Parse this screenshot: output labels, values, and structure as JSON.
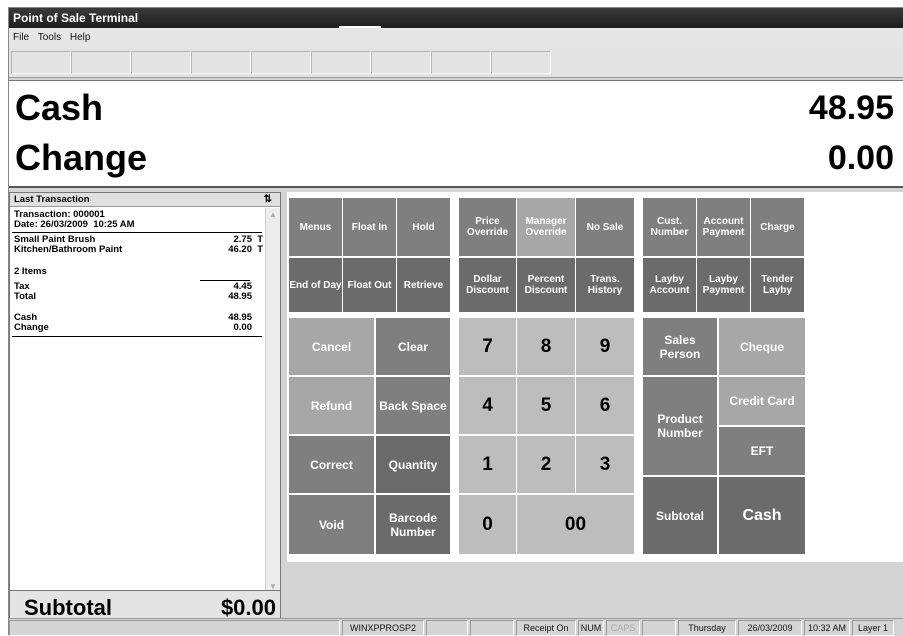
{
  "window": {
    "title": "Point of Sale Terminal"
  },
  "menu": {
    "items": [
      "File",
      "Tools",
      "Help"
    ]
  },
  "display": {
    "line1_label": "Cash",
    "line1_value": "48.95",
    "line2_label": "Change",
    "line2_value": "0.00"
  },
  "receipt": {
    "header": "Last Transaction",
    "sort_icon": "⇅",
    "transaction": "Transaction: 000001",
    "date": "Date: 26/03/2009  10:25 AM",
    "items": [
      {
        "name": "Small Paint Brush",
        "price": "2.75",
        "flag": "T"
      },
      {
        "name": "Kitchen/Bathroom Paint",
        "price": "46.20",
        "flag": "T"
      }
    ],
    "item_count": "2 Items",
    "tax_label": "Tax",
    "tax": "4.45",
    "total_label": "Total",
    "total": "48.95",
    "cash_label": "Cash",
    "cash": "48.95",
    "change_label": "Change",
    "change": "0.00"
  },
  "subtotal": {
    "label": "Subtotal",
    "value": "$0.00"
  },
  "keys": {
    "menus": "Menus",
    "float_in": "Float In",
    "hold": "Hold",
    "price_override": "Price Override",
    "manager_override": "Manager Override",
    "no_sale": "No Sale",
    "cust_number": "Cust. Number",
    "account_payment": "Account Payment",
    "charge": "Charge",
    "end_of_day": "End of Day",
    "float_out": "Float Out",
    "retrieve": "Retrieve",
    "dollar_discount": "Dollar Discount",
    "percent_discount": "Percent Discount",
    "trans_history": "Trans. History",
    "layby_account": "Layby Account",
    "layby_payment": "Layby Payment",
    "tender_layby": "Tender Layby",
    "cancel": "Cancel",
    "clear": "Clear",
    "refund": "Refund",
    "back_space": "Back Space",
    "correct": "Correct",
    "quantity": "Quantity",
    "void": "Void",
    "barcode_number": "Barcode Number",
    "n7": "7",
    "n8": "8",
    "n9": "9",
    "n4": "4",
    "n5": "5",
    "n6": "6",
    "n1": "1",
    "n2": "2",
    "n3": "3",
    "n0": "0",
    "n00": "00",
    "sales_person": "Sales Person",
    "product_number": "Product Number",
    "subtotal": "Subtotal",
    "cheque": "Cheque",
    "credit_card": "Credit Card",
    "eft": "EFT",
    "cash": "Cash"
  },
  "status": {
    "machine": "WINXPPROSP2",
    "receipt": "Receipt On",
    "num": "NUM",
    "caps": "CAPS",
    "day": "Thursday",
    "date": "26/03/2009",
    "time": "10:32 AM",
    "layer": "Layer 1"
  }
}
